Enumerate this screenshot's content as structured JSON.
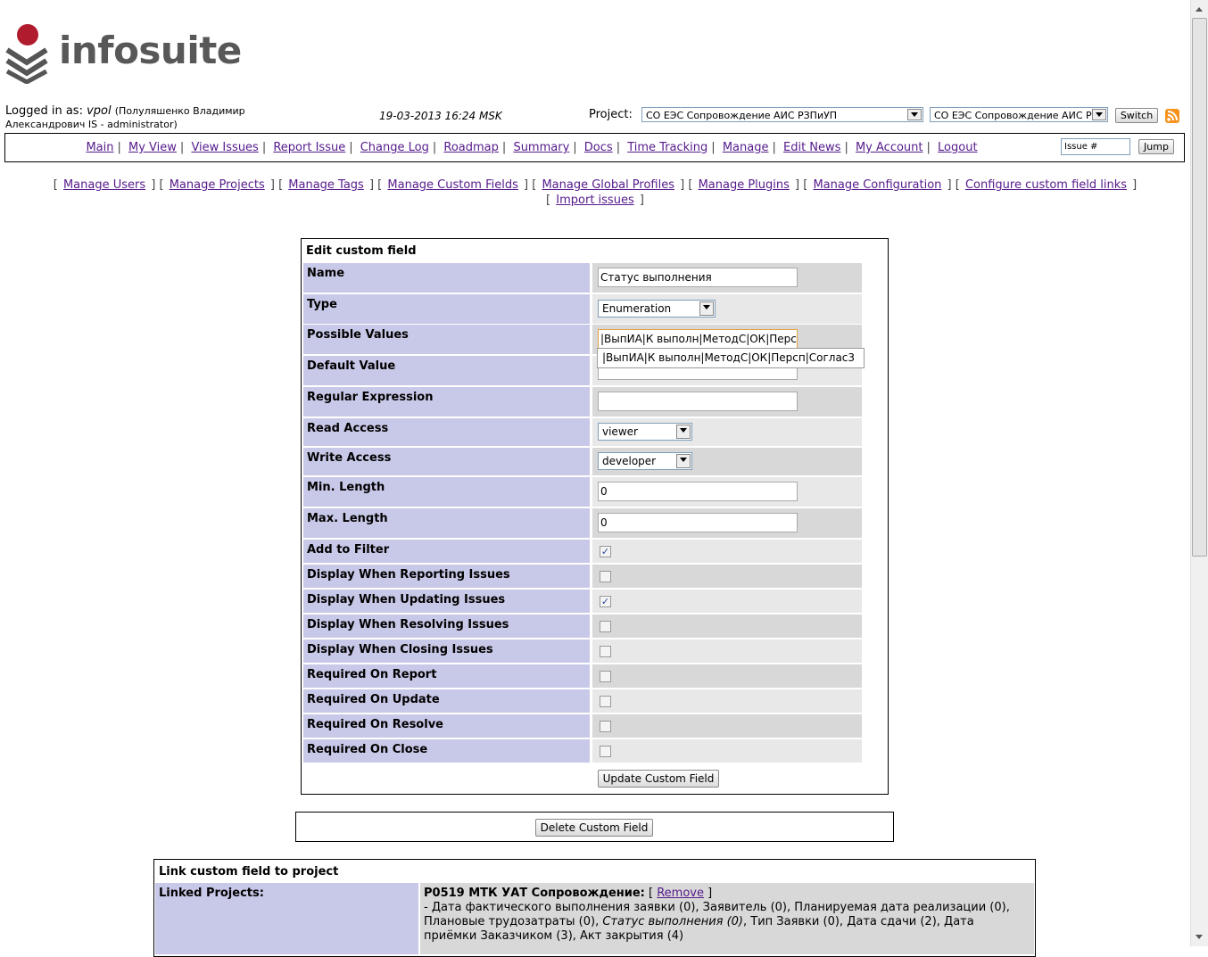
{
  "header": {
    "logo_text": "infosuite",
    "logged_in_prefix": "Logged in as:",
    "user": "vpol",
    "user_fullname_1": "(Полуляшенко Владимир",
    "user_fullname_2": "Александрович IS - administrator)",
    "datetime": "19-03-2013 16:24 MSK",
    "project_label": "Project:",
    "project_select_1": "СО ЕЭС Сопровождение АИС РЗПиУП",
    "project_select_2": "СО ЕЭС Сопровождение АИС РЗI",
    "switch_label": "Switch"
  },
  "menu": {
    "items": [
      "Main",
      "My View",
      "View Issues",
      "Report Issue",
      "Change Log",
      "Roadmap",
      "Summary",
      "Docs",
      "Time Tracking",
      "Manage",
      "Edit News",
      "My Account",
      "Logout"
    ],
    "issue_placeholder": "Issue #",
    "jump_label": "Jump"
  },
  "admin_links": [
    "Manage Users",
    "Manage Projects",
    "Manage Tags",
    "Manage Custom Fields",
    "Manage Global Profiles",
    "Manage Plugins",
    "Manage Configuration",
    "Configure custom field links",
    "Import issues"
  ],
  "form": {
    "title": "Edit custom field",
    "fields": {
      "name_label": "Name",
      "name_value": "Статус выполнения",
      "type_label": "Type",
      "type_value": "Enumeration",
      "possible_label": "Possible Values",
      "possible_value": "|ВыпИА|К выполн|МетодС|ОК|Персп|С",
      "default_label": "Default Value",
      "default_value": "",
      "regex_label": "Regular Expression",
      "regex_value": "",
      "read_label": "Read Access",
      "read_value": "viewer",
      "write_label": "Write Access",
      "write_value": "developer",
      "min_label": "Min. Length",
      "min_value": "0",
      "max_label": "Max. Length",
      "max_value": "0"
    },
    "autocomplete_suggestion": "|ВыпИА|К выполн|МетодС|ОК|Персп|Соглас3",
    "checkboxes": [
      {
        "label": "Add to Filter",
        "checked": true
      },
      {
        "label": "Display When Reporting Issues",
        "checked": false
      },
      {
        "label": "Display When Updating Issues",
        "checked": true
      },
      {
        "label": "Display When Resolving Issues",
        "checked": false
      },
      {
        "label": "Display When Closing Issues",
        "checked": false
      },
      {
        "label": "Required On Report",
        "checked": false
      },
      {
        "label": "Required On Update",
        "checked": false
      },
      {
        "label": "Required On Resolve",
        "checked": false
      },
      {
        "label": "Required On Close",
        "checked": false
      }
    ],
    "update_label": "Update Custom Field"
  },
  "delete_label": "Delete Custom Field",
  "link_section": {
    "title": "Link custom field to project",
    "linked_label": "Linked Projects:",
    "project_name": "P0519 МТК УАТ Сопровождение:",
    "remove_label": "Remove",
    "fields_before": "- Дата фактического выполнения заявки (0), Заявитель (0), Планируемая дата реализации (0), Плановые трудозатраты (0), ",
    "fields_current": "Статус выполнения (0)",
    "fields_after": ", Тип Заявки (0), Дата сдачи (2), Дата приёмки Заказчиком (3), Акт закрытия (4)"
  }
}
